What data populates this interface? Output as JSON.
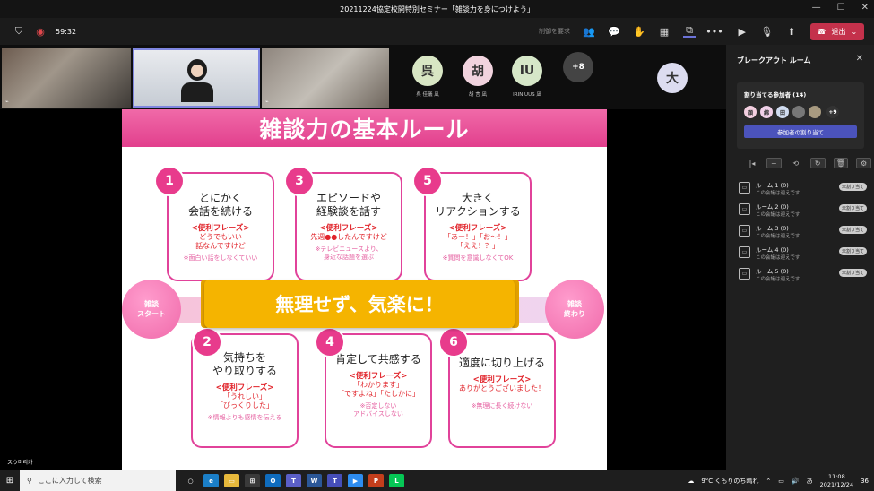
{
  "window": {
    "title": "20211224協定校開特別セミナー「雑談力を身につけよう」"
  },
  "toolbar": {
    "timer": "59:32",
    "control_request": "制御を要求",
    "leave_label": "退出"
  },
  "participants": [
    {
      "initial": "呉",
      "name": "呉 佳儀 凪",
      "color": "#d8e6c4"
    },
    {
      "initial": "胡",
      "name": "胡 言 凪",
      "color": "#f1d3de"
    },
    {
      "initial": "IU",
      "name": "IRIN UUS 凪",
      "color": "#d6e7c8"
    },
    {
      "initial": "+8",
      "name": "",
      "color": "#444444"
    }
  ],
  "extra_participant": {
    "initial": "大",
    "color": "#dcdcf0"
  },
  "slide": {
    "title": "雑談力の基本ルール",
    "start_label": "雑談\nスタート",
    "end_label": "雑談\n終わり",
    "banner": "無理せず、気楽に！",
    "rules": [
      {
        "num": "1",
        "title": "とにかく\n会話を続ける",
        "phrase_head": "<便利フレーズ>",
        "phrase": "どうでもいい\n話なんですけど",
        "note": "※面白い話をしなくていい"
      },
      {
        "num": "3",
        "title": "エピソードや\n経験談を話す",
        "phrase_head": "<便利フレーズ>",
        "phrase": "先週●●したんですけど",
        "note": "※テレビニュースより、\n身近な話題を選ぶ"
      },
      {
        "num": "5",
        "title": "大きく\nリアクションする",
        "phrase_head": "<便利フレーズ>",
        "phrase": "「あー！」「お～！」\n「ええ！？」",
        "note": "※質問を意識しなくてOK"
      },
      {
        "num": "2",
        "title": "気持ちを\nやり取りする",
        "phrase_head": "<便利フレーズ>",
        "phrase": "「うれしい」\n「びっくりした」",
        "note": "※情報よりも感情を伝える"
      },
      {
        "num": "4",
        "title": "肯定して共感する",
        "phrase_head": "<便利フレーズ>",
        "phrase": "「わかります」\n「ですよね」「たしかに」",
        "note": "※否定しない\nアドバイスしない"
      },
      {
        "num": "6",
        "title": "適度に切り上げる",
        "phrase_head": "<便利フレーズ>",
        "phrase": "ありがとうございました！",
        "note": "※無理に長く続けない"
      }
    ]
  },
  "breakout": {
    "title": "ブレークアウト ルーム",
    "assign_label": "割り当てる参加者 (14)",
    "avatars": [
      {
        "initial": "顔",
        "color": "#f3cfe0"
      },
      {
        "initial": "綿",
        "color": "#f0d0e8"
      },
      {
        "initial": "田",
        "color": "#d0dcf0"
      },
      {
        "initial": "",
        "color": "#777777"
      },
      {
        "initial": "",
        "color": "#a89a80"
      }
    ],
    "more": "+9",
    "assign_button": "参加者の割り当て",
    "rooms": [
      {
        "name": "ルーム 1 (0)",
        "status": "この会議は迎えです",
        "badge": "未割り当て"
      },
      {
        "name": "ルーム 2 (0)",
        "status": "この会議は迎えです",
        "badge": "未割り当て"
      },
      {
        "name": "ルーム 3 (0)",
        "status": "この会議は迎えです",
        "badge": "未割り当て"
      },
      {
        "name": "ルーム 4 (0)",
        "status": "この会議は迎えです",
        "badge": "未割り当て"
      },
      {
        "name": "ルーム 5 (0)",
        "status": "この会議は迎えです",
        "badge": "未割り当て"
      }
    ]
  },
  "presenter_name": "スウ미리카",
  "taskbar": {
    "search_placeholder": "ここに入力して検索",
    "weather": "9°C くもりのち晴れ",
    "time": "11:08",
    "date": "2021/12/24",
    "ime": "あ",
    "notifications": "36"
  }
}
